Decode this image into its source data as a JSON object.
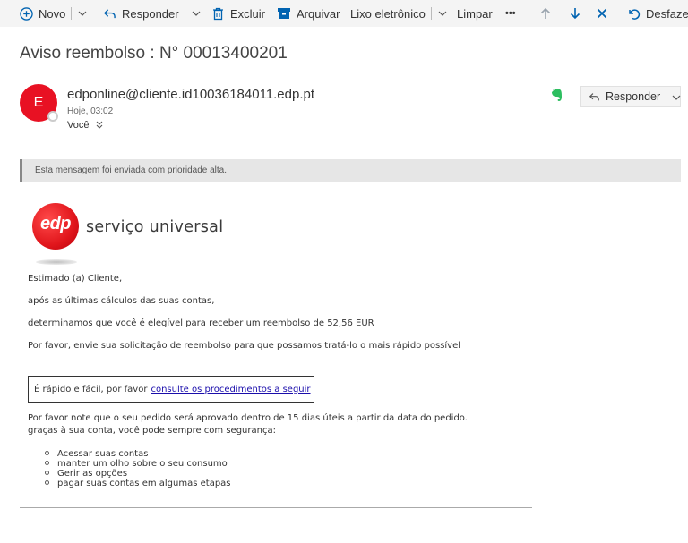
{
  "toolbar": {
    "new_label": "Novo",
    "reply_label": "Responder",
    "delete_label": "Excluir",
    "archive_label": "Arquivar",
    "junk_label": "Lixo eletrônico",
    "sweep_label": "Limpar",
    "more_label": "•••",
    "undo_label": "Desfazer"
  },
  "message": {
    "subject": "Aviso reembolso : N° 00013400201",
    "avatar_initial": "E",
    "sender": "edponline@cliente.id10036184011.edp.pt",
    "time": "Hoje, 03:02",
    "to": "Você",
    "reply_button_label": "Responder",
    "priority_notice": "Esta mensagem foi enviada com prioridade alta."
  },
  "email": {
    "logo_text": "edp",
    "brand_text": "serviço universal",
    "greeting": "Estimado (a) Cliente,",
    "line1": "após as últimas cálculos das suas contas,",
    "line2": "determinamos que você é elegível para receber um reembolso de 52,56 EUR",
    "line3": "Por favor, envie sua solicitação de reembolso para que possamos tratá-lo o mais rápido possível",
    "cta_text": "É rápido e fácil, por favor",
    "cta_link": "consulte os procedimentos a seguir",
    "note1": "Por favor note que o seu pedido será aprovado dentro de 15 dias úteis a partir da data do pedido.",
    "note2": "graças à sua conta, você pode sempre com segurança:",
    "list": [
      "Acessar suas contas",
      "manter um olho sobre o seu consumo",
      "Gerir as opções",
      "pagar suas contas em algumas etapas"
    ]
  },
  "colors": {
    "avatar": "#e81123",
    "brand_red": "#e1161c",
    "toolbar_bg": "#f4f4f4",
    "accent_blue": "#0063b1"
  }
}
